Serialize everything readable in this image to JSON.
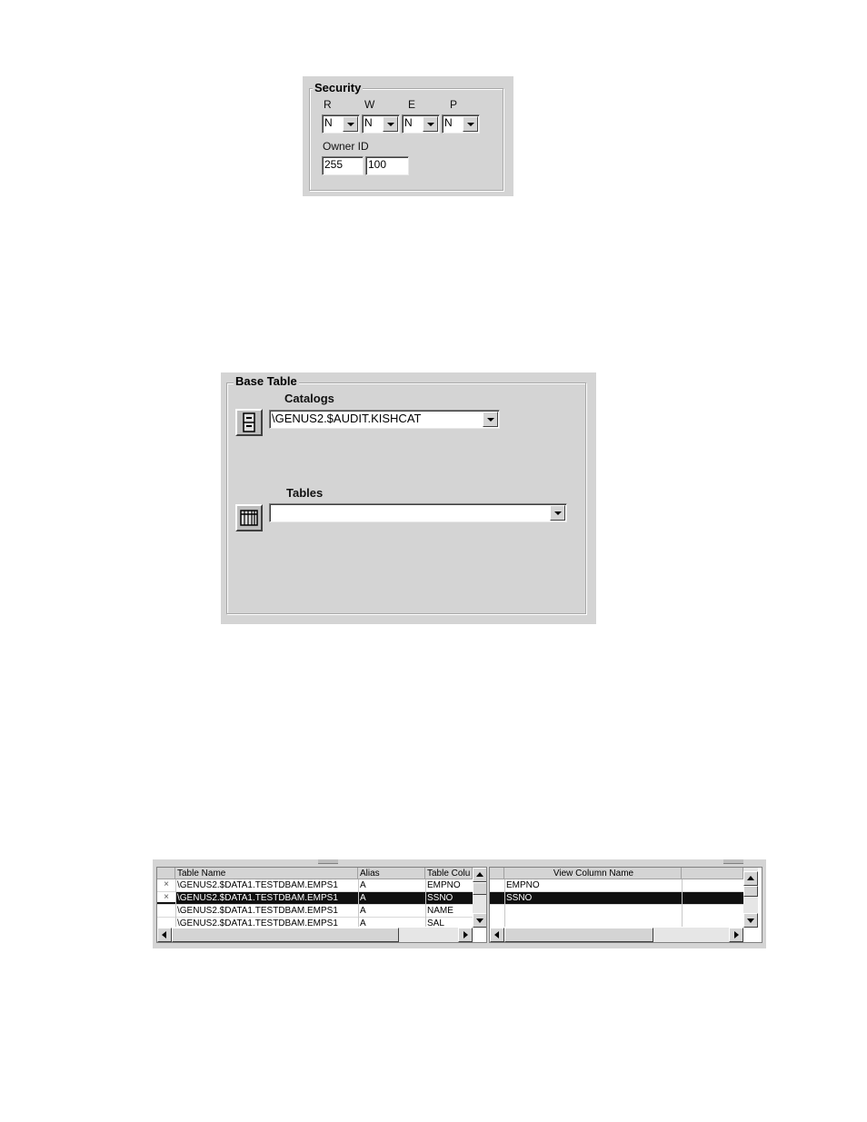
{
  "security": {
    "title": "Security",
    "columns": [
      "R",
      "W",
      "E",
      "P"
    ],
    "values": [
      "N",
      "N",
      "N",
      "N"
    ],
    "owner_label": "Owner ID",
    "owner_group": "255",
    "owner_user": "100"
  },
  "base_table": {
    "title": "Base Table",
    "catalogs_label": "Catalogs",
    "catalog_value": "\\GENUS2.$AUDIT.KISHCAT",
    "tables_label": "Tables",
    "table_value": ""
  },
  "left_grid": {
    "headers": [
      "Table Name",
      "Alias",
      "Table Colu"
    ],
    "rows": [
      {
        "mark": "×",
        "table": "\\GENUS2.$DATA1.TESTDBAM.EMPS1",
        "alias": "A",
        "column": "EMPNO",
        "selected": false
      },
      {
        "mark": "×",
        "table": "\\GENUS2.$DATA1.TESTDBAM.EMPS1",
        "alias": "A",
        "column": "SSNO",
        "selected": true
      },
      {
        "mark": "",
        "table": "\\GENUS2.$DATA1.TESTDBAM.EMPS1",
        "alias": "A",
        "column": "NAME",
        "selected": false
      },
      {
        "mark": "",
        "table": "\\GENUS2.$DATA1.TESTDBAM.EMPS1",
        "alias": "A",
        "column": "SAL",
        "selected": false
      }
    ]
  },
  "right_grid": {
    "header": "View Column Name",
    "rows": [
      {
        "name": "EMPNO",
        "selected": false
      },
      {
        "name": "SSNO",
        "selected": true
      }
    ]
  }
}
